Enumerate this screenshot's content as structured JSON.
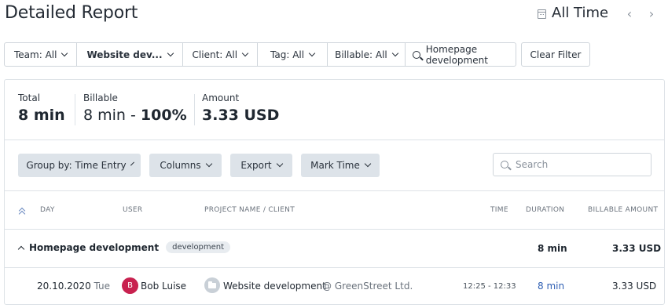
{
  "header": {
    "title": "Detailed Report",
    "range_label": "All Time",
    "prev": "‹",
    "next": "›"
  },
  "filters": {
    "items": [
      {
        "label": "Team: All",
        "bold": false
      },
      {
        "label": "Website dev...",
        "bold": true
      },
      {
        "label": "Client: All",
        "bold": false
      },
      {
        "label": "Tag: All",
        "bold": false
      },
      {
        "label": "Billable: All",
        "bold": false
      }
    ],
    "search_value": "Homepage development",
    "clear_label": "Clear Filter"
  },
  "summary": {
    "total_label": "Total",
    "total_value": "8 min",
    "billable_label": "Billable",
    "billable_value": "8 min",
    "billable_separator": " - ",
    "billable_percent": "100%",
    "amount_label": "Amount",
    "amount_value": "3.33 USD"
  },
  "toolbar": {
    "group_by": "Group by: Time Entry",
    "columns": "Columns",
    "export": "Export",
    "mark_time": "Mark Time",
    "search_placeholder": "Search"
  },
  "table": {
    "headers": {
      "day": "DAY",
      "user": "USER",
      "project": "PROJECT NAME / CLIENT",
      "time": "TIME",
      "duration": "DURATION",
      "billable_amount": "BILLABLE AMOUNT"
    },
    "group": {
      "name": "Homepage development",
      "tag": "development",
      "duration": "8 min",
      "amount": "3.33 USD"
    },
    "rows": [
      {
        "date": "20.10.2020",
        "weekday": "Tue",
        "avatar_letter": "B",
        "user": "Bob Luise",
        "project": "Website development",
        "client": "@ GreenStreet Ltd.",
        "time": "12:25 - 12:33",
        "duration": "8 min",
        "amount": "3.33 USD"
      }
    ]
  },
  "colors": {
    "avatar": "#c8214f",
    "link": "#2f5fb3",
    "button_bg": "#dde3e9"
  }
}
